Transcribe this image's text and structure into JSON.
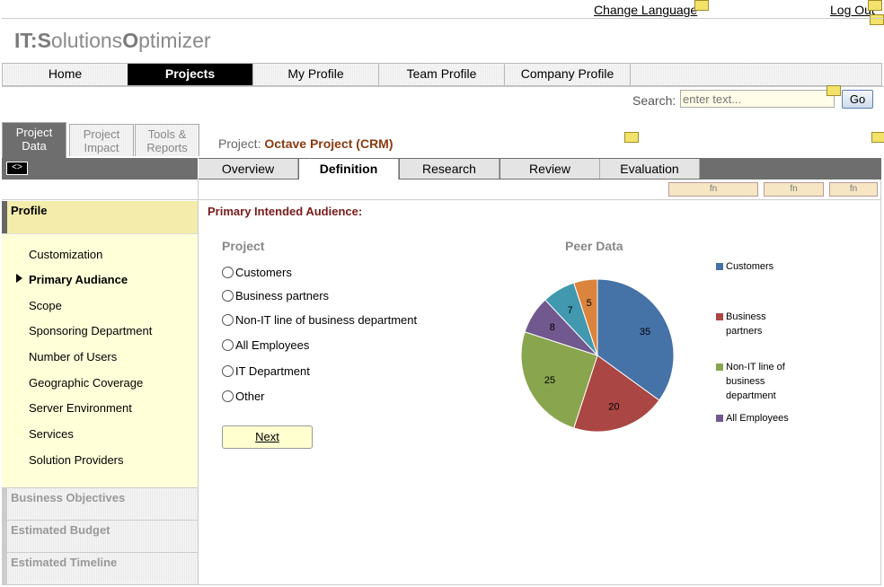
{
  "top": {
    "change_language": "Change Language",
    "log_out": "Log Out"
  },
  "logo": {
    "p1": "IT:",
    "p2": "S",
    "p3": "olutions",
    "p4": "O",
    "p5": "ptimizer"
  },
  "nav": [
    "Home",
    "Projects",
    "My Profile",
    "Team Profile",
    "Company Profile"
  ],
  "nav_active": "Projects",
  "search": {
    "label": "Search:",
    "placeholder": "enter text...",
    "button": "Go"
  },
  "left_tabs": [
    {
      "l1": "Project",
      "l2": "Data"
    },
    {
      "l1": "Project",
      "l2": "Impact"
    },
    {
      "l1": "Tools &",
      "l2": "Reports"
    }
  ],
  "toggle": "<>",
  "project": {
    "label": "Project:",
    "name": "Octave Project (CRM)"
  },
  "sub_tabs": [
    "Overview",
    "Definition",
    "Research",
    "Review",
    "Evaluation"
  ],
  "sub_tab_active": "Definition",
  "fn_buttons": [
    "fn",
    "fn",
    "fn"
  ],
  "sidebar": {
    "profile": "Profile",
    "items": [
      "Customization",
      "Primary Audiance",
      "Scope",
      "Sponsoring Department",
      "Number of Users",
      "Geographic Coverage",
      "Server Environment",
      "Services",
      "Solution Providers"
    ],
    "active": "Primary Audiance",
    "sections": [
      "Business Objectives",
      "Estimated Budget",
      "Estimated Timeline"
    ]
  },
  "question": {
    "title": "Primary Intended Audience:",
    "project_head": "Project",
    "peer_head": "Peer Data"
  },
  "options": [
    "Customers",
    "Business partners",
    "Non-IT line of business department",
    "All Employees",
    "IT Department",
    "Other"
  ],
  "next": "Next",
  "chart_data": {
    "type": "pie",
    "categories": [
      "Customers",
      "Business partners",
      "Non-IT line of business department",
      "All Employees",
      "IT Department",
      "Other"
    ],
    "values": [
      35,
      20,
      25,
      8,
      7,
      5
    ],
    "colors": [
      "#4572a7",
      "#aa4643",
      "#89a54e",
      "#71588f",
      "#4198af",
      "#db843d"
    ],
    "legend": [
      "Customers",
      "Business partners",
      "Non-IT line of business department",
      "All Employees"
    ],
    "legend_placement": "right",
    "title": ""
  }
}
